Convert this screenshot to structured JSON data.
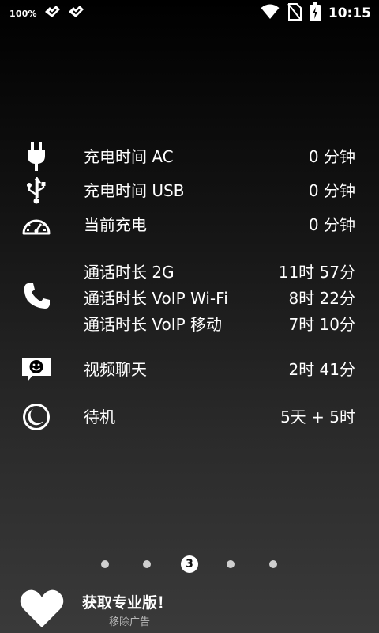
{
  "status_bar": {
    "battery_percent": "100%",
    "time": "10:15",
    "icons": [
      "notification-icon",
      "notification-icon",
      "wifi-icon",
      "no-sim-icon",
      "battery-charging-icon"
    ]
  },
  "stats": {
    "charge_ac": {
      "label": "充电时间 AC",
      "value": "0 分钟",
      "icon": "plug-icon"
    },
    "charge_usb": {
      "label": "充电时间 USB",
      "value": "0 分钟",
      "icon": "usb-icon"
    },
    "current_charge": {
      "label": "当前充电",
      "value": "0 分钟",
      "icon": "speedometer-icon"
    },
    "calls": {
      "icon": "phone-icon",
      "items": [
        {
          "label": "通话时长 2G",
          "value": "11时 57分"
        },
        {
          "label": "通话时长 VoIP Wi-Fi",
          "value": "8时 22分"
        },
        {
          "label": "通话时长 VoIP 移动",
          "value": "7时 10分"
        }
      ]
    },
    "video_chat": {
      "label": "视频聊天",
      "value": "2时 41分",
      "icon": "video-chat-icon"
    },
    "standby": {
      "label": "待机",
      "value": "5天 + 5时",
      "icon": "moon-icon"
    }
  },
  "pager": {
    "current_page": "3",
    "total_pages": 5
  },
  "promo": {
    "title": "获取专业版！",
    "subtitle": "移除广告",
    "icon": "heart-icon"
  }
}
